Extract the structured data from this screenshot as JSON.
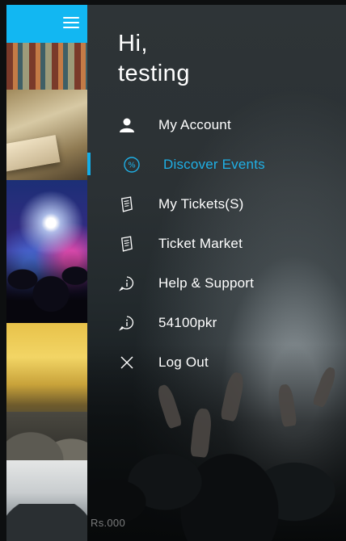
{
  "drawer": {
    "greeting_line1": "Hi,",
    "greeting_line2": "testing",
    "items": [
      {
        "label": "My Account",
        "icon": "user-icon",
        "active": false
      },
      {
        "label": "Discover Events",
        "icon": "percent-circle-icon",
        "active": true
      },
      {
        "label": "My Tickets(S)",
        "icon": "ticket-icon",
        "active": false
      },
      {
        "label": "Ticket Market",
        "icon": "ticket-icon",
        "active": false
      },
      {
        "label": "Help & Support",
        "icon": "info-bubble-icon",
        "active": false
      },
      {
        "label": "54100pkr",
        "icon": "info-bubble-icon",
        "active": false
      },
      {
        "label": "Log Out",
        "icon": "close-icon",
        "active": false
      }
    ]
  },
  "background": {
    "price_text": "Rs.000"
  },
  "colors": {
    "accent": "#14aee8",
    "topbar": "#12b7f2",
    "text": "#ffffff"
  }
}
